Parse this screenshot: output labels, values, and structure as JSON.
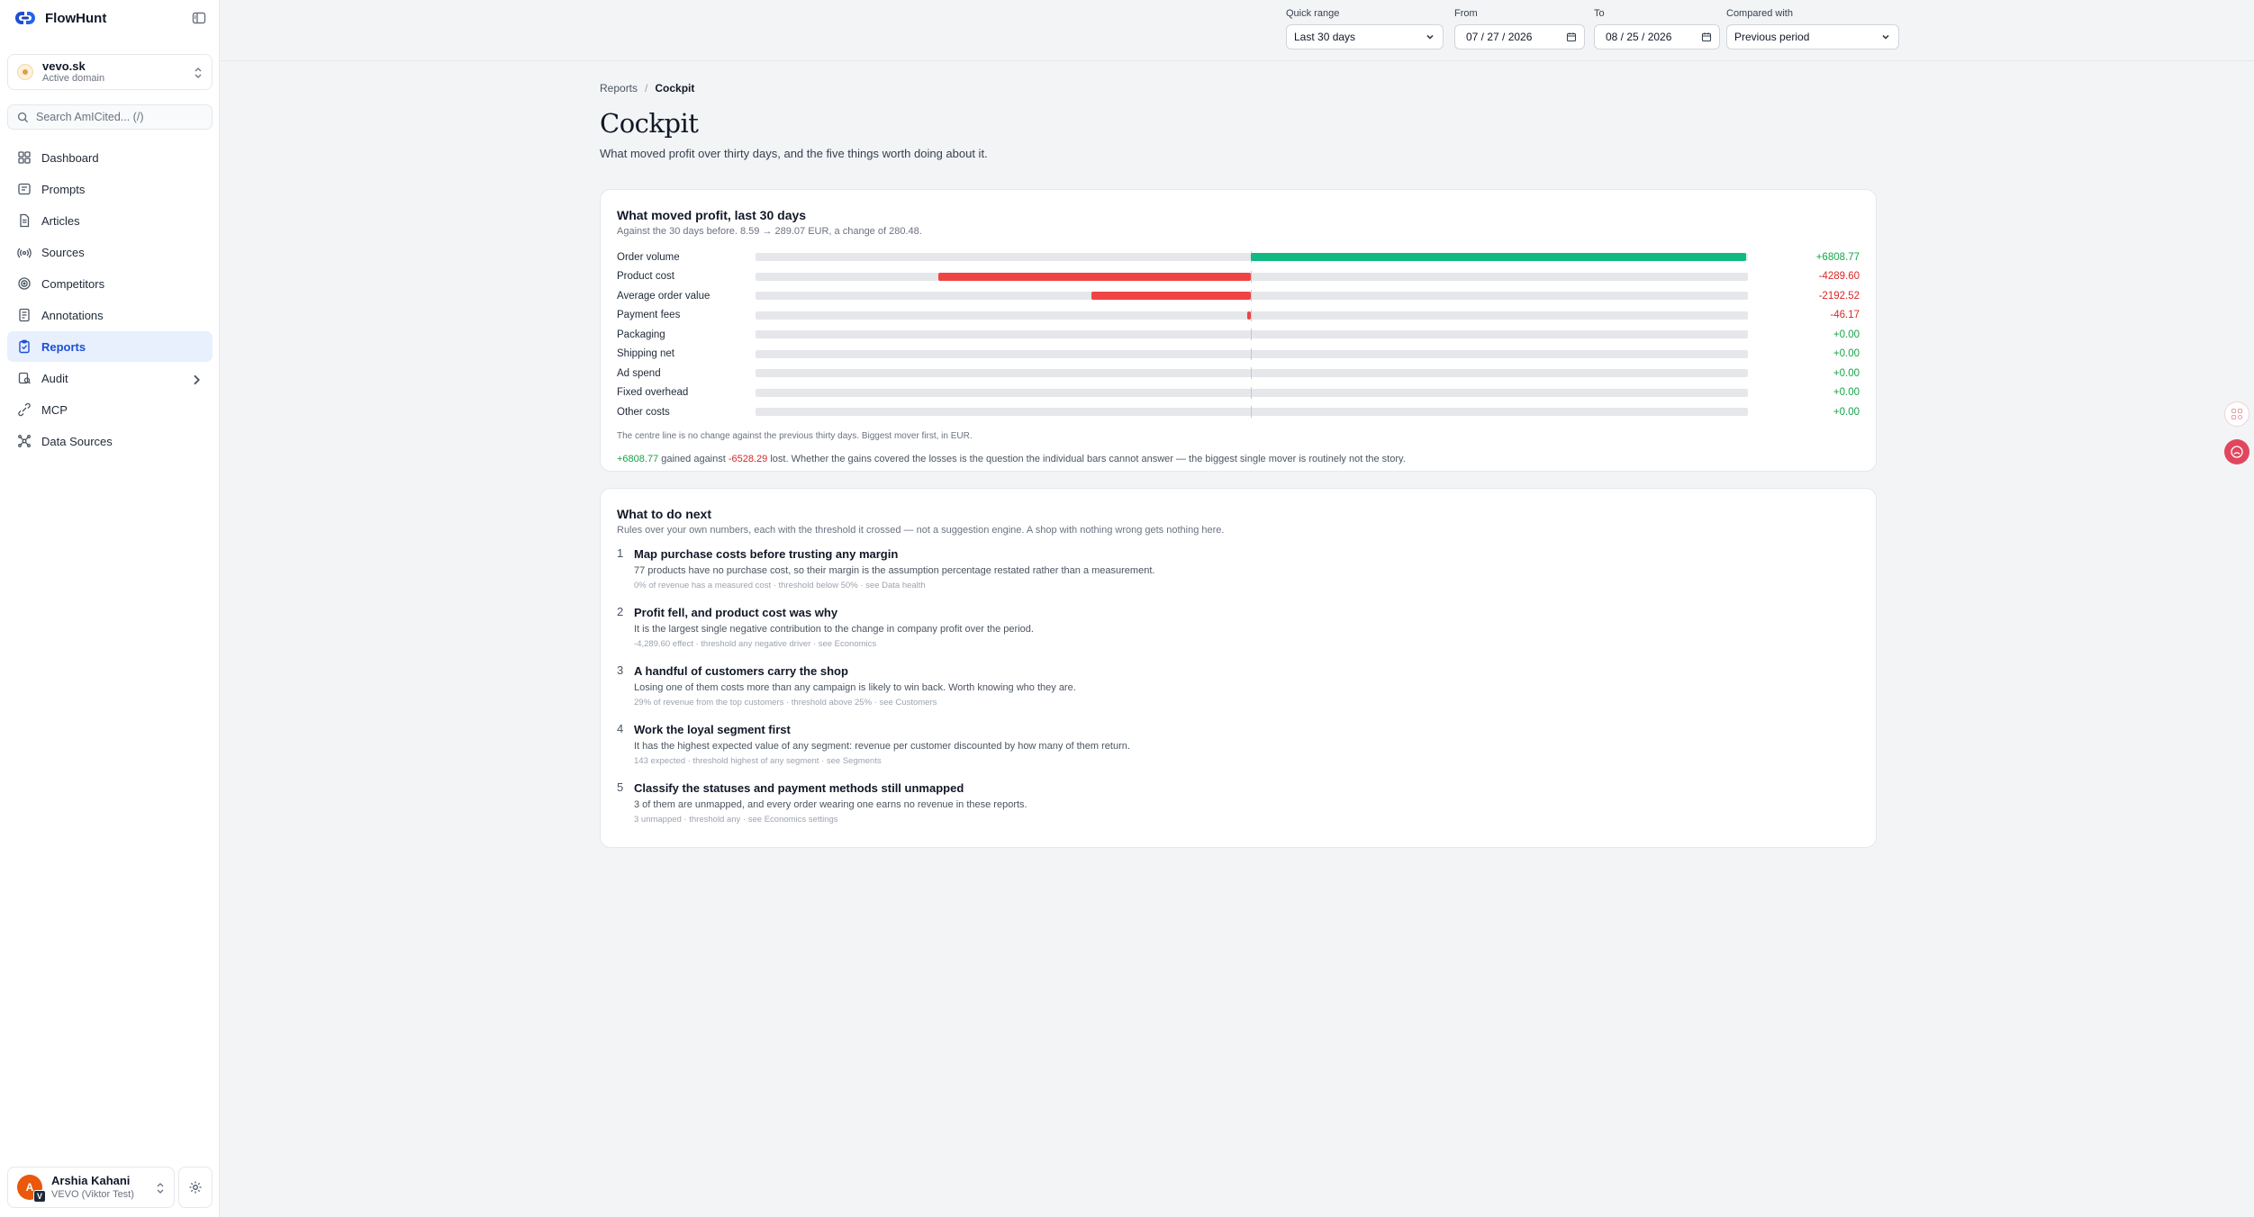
{
  "app": {
    "name": "FlowHunt"
  },
  "domain": {
    "name": "vevo.sk",
    "status": "Active domain"
  },
  "search": {
    "placeholder": "Search AmICited... (/)"
  },
  "nav": [
    {
      "label": "Dashboard",
      "icon": "dashboard-icon",
      "active": false
    },
    {
      "label": "Prompts",
      "icon": "prompts-icon",
      "active": false
    },
    {
      "label": "Articles",
      "icon": "articles-icon",
      "active": false
    },
    {
      "label": "Sources",
      "icon": "sources-icon",
      "active": false
    },
    {
      "label": "Competitors",
      "icon": "competitors-icon",
      "active": false
    },
    {
      "label": "Annotations",
      "icon": "annotations-icon",
      "active": false
    },
    {
      "label": "Reports",
      "icon": "reports-icon",
      "active": true
    },
    {
      "label": "Audit",
      "icon": "audit-icon",
      "active": false
    },
    {
      "label": "MCP",
      "icon": "mcp-icon",
      "active": false
    },
    {
      "label": "Data Sources",
      "icon": "data-sources-icon",
      "active": false
    }
  ],
  "user": {
    "name": "Arshia Kahani",
    "org": "VEVO (Viktor Test)",
    "initial": "A",
    "badge": "V"
  },
  "filters": {
    "quick_range": {
      "label": "Quick range",
      "value": "Last 30 days"
    },
    "from": {
      "label": "From",
      "value": "07 / 27 / 2026"
    },
    "to": {
      "label": "To",
      "value": "08 / 25 / 2026"
    },
    "compared": {
      "label": "Compared with",
      "value": "Previous period"
    }
  },
  "breadcrumb": {
    "parent": "Reports",
    "separator": "/",
    "current": "Cockpit"
  },
  "page": {
    "title": "Cockpit",
    "subtitle": "What moved profit over thirty days, and the five things worth doing about it."
  },
  "profit": {
    "title": "What moved profit, last 30 days",
    "subtitle": "Against the 30 days before. 8.59 → 289.07 EUR, a change of 280.48.",
    "max_abs": 6808.77,
    "colors": {
      "positive": "#10b981",
      "negative": "#ef4444"
    },
    "rows": [
      {
        "label": "Order volume",
        "value": 6808.77,
        "display": "+6808.77"
      },
      {
        "label": "Product cost",
        "value": -4289.6,
        "display": "-4289.60"
      },
      {
        "label": "Average order value",
        "value": -2192.52,
        "display": "-2192.52"
      },
      {
        "label": "Payment fees",
        "value": -46.17,
        "display": "-46.17"
      },
      {
        "label": "Packaging",
        "value": 0,
        "display": "+0.00"
      },
      {
        "label": "Shipping net",
        "value": 0,
        "display": "+0.00"
      },
      {
        "label": "Ad spend",
        "value": 0,
        "display": "+0.00"
      },
      {
        "label": "Fixed overhead",
        "value": 0,
        "display": "+0.00"
      },
      {
        "label": "Other costs",
        "value": 0,
        "display": "+0.00"
      }
    ],
    "note": "The centre line is no change against the previous thirty days. Biggest mover first, in EUR.",
    "summary": {
      "gained": "+6808.77",
      "text1": " gained against ",
      "lost": "-6528.29",
      "text2": " lost. Whether the gains covered the losses is the question the individual bars cannot answer — the biggest single mover is routinely not the story."
    }
  },
  "next": {
    "title": "What to do next",
    "subtitle": "Rules over your own numbers, each with the threshold it crossed — not a suggestion engine. A shop with nothing wrong gets nothing here.",
    "items": [
      {
        "num": "1",
        "title": "Map purchase costs before trusting any margin",
        "body": "77 products have no purchase cost, so their margin is the assumption percentage restated rather than a measurement.",
        "meta": "0% of revenue has a measured cost · threshold below 50% · see Data health"
      },
      {
        "num": "2",
        "title": "Profit fell, and product cost was why",
        "body": "It is the largest single negative contribution to the change in company profit over the period.",
        "meta": "-4,289.60 effect · threshold any negative driver · see Economics"
      },
      {
        "num": "3",
        "title": "A handful of customers carry the shop",
        "body": "Losing one of them costs more than any campaign is likely to win back. Worth knowing who they are.",
        "meta": "29% of revenue from the top customers · threshold above 25% · see Customers"
      },
      {
        "num": "4",
        "title": "Work the loyal segment first",
        "body": "It has the highest expected value of any segment: revenue per customer discounted by how many of them return.",
        "meta": "143 expected · threshold highest of any segment · see Segments"
      },
      {
        "num": "5",
        "title": "Classify the statuses and payment methods still unmapped",
        "body": "3 of them are unmapped, and every order wearing one earns no revenue in these reports.",
        "meta": "3 unmapped · threshold any · see Economics settings"
      }
    ]
  }
}
